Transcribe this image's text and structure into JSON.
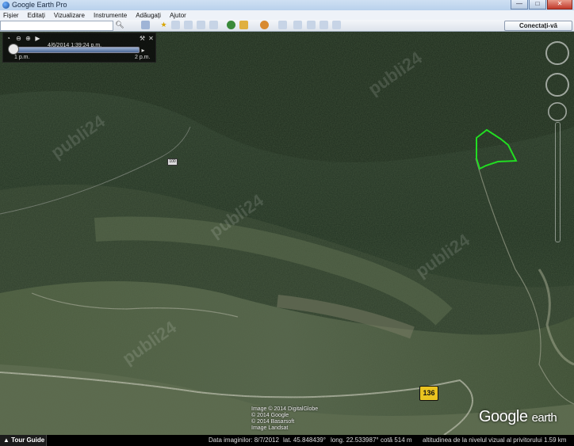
{
  "window": {
    "title": "Google Earth Pro",
    "minimize": "—",
    "maximize": "□",
    "close": "✕"
  },
  "menu": [
    "Fișier",
    "Editați",
    "Vizualizare",
    "Instrumente",
    "Adăugați",
    "Ajutor"
  ],
  "toolbar": {
    "connect_label": "Conectați-vă"
  },
  "time_panel": {
    "timestamp": "4/6/2014   1:39:24 p.m.",
    "start_label": "1 p.m.",
    "end_label": "2 p.m."
  },
  "map": {
    "credits": [
      "Image © 2014 DigitalGlobe",
      "© 2014 Google",
      "© 2014 Basarsoft",
      "Image Landsat"
    ],
    "road_shield": "136",
    "road_small": "100",
    "logo_word1": "Google",
    "logo_word2": "earth",
    "watermark": "publi24"
  },
  "status": {
    "tour_guide": "Tour Guide",
    "imagery_date": "Data imaginilor: 8/7/2012",
    "lat": "lat.  45.848439°",
    "lon": "long.  22.533987°",
    "elevation": "cotă   514 m",
    "eye_alt": "altitudinea de la nivelul vizual al privitorului  1.59 km"
  },
  "colors": {
    "polygon": "#22dd22",
    "shield": "#e9c320"
  }
}
